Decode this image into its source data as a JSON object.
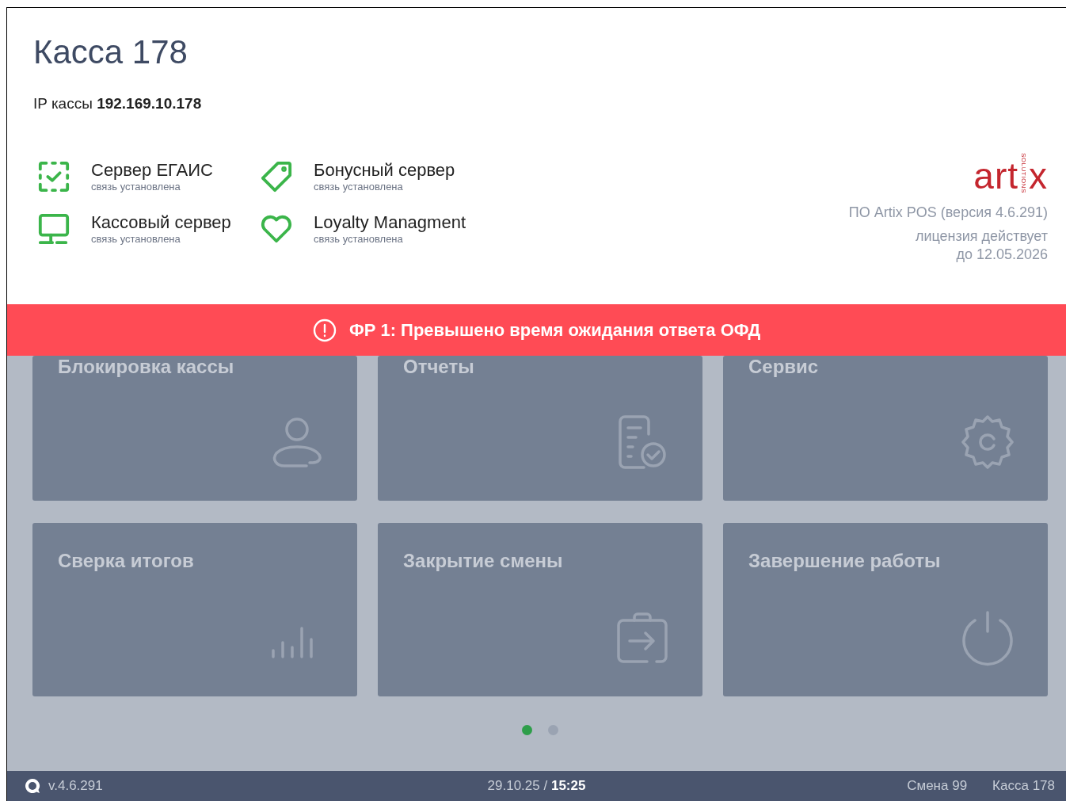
{
  "header": {
    "title": "Касса 178",
    "ip_label": "IP кассы",
    "ip_value": "192.169.10.178"
  },
  "services": [
    {
      "kind": "egais",
      "name": "Сервер ЕГАИС",
      "status": "связь установлена",
      "connected": true
    },
    {
      "kind": "tag",
      "name": "Бонусный сервер",
      "status": "связь установлена",
      "connected": true
    },
    {
      "kind": "monitor",
      "name": "Кассовый сервер",
      "status": "связь установлена",
      "connected": true
    },
    {
      "kind": "heart",
      "name": "Loyalty Managment",
      "status": "связь установлена",
      "connected": true
    }
  ],
  "about": {
    "logo_parts": [
      "art",
      "x"
    ],
    "logo_tagline": "SOLUTIONS",
    "product": "ПО Artix POS (версия 4.6.291)",
    "license_lines": [
      "лицензия действует",
      "до 12.05.2026"
    ]
  },
  "alert": {
    "text": "ФР 1: Превышено время ожидания ответа ОФД"
  },
  "tiles": [
    {
      "title": "Блокировка кассы",
      "kind": "user"
    },
    {
      "title": "Отчеты",
      "kind": "report"
    },
    {
      "title": "Сервис",
      "kind": "gear"
    },
    {
      "title": "Сверка итогов",
      "kind": "chart"
    },
    {
      "title": "Закрытие смены",
      "kind": "exit"
    },
    {
      "title": "Завершение работы",
      "kind": "power"
    }
  ],
  "pages": [
    {
      "selected": true
    },
    {
      "selected": false
    }
  ],
  "status_bar": {
    "version": "v.4.6.291",
    "date": "29.10.25",
    "separator": "/",
    "time": "15:25",
    "shift": "Смена 99",
    "register": "Касса 178"
  }
}
